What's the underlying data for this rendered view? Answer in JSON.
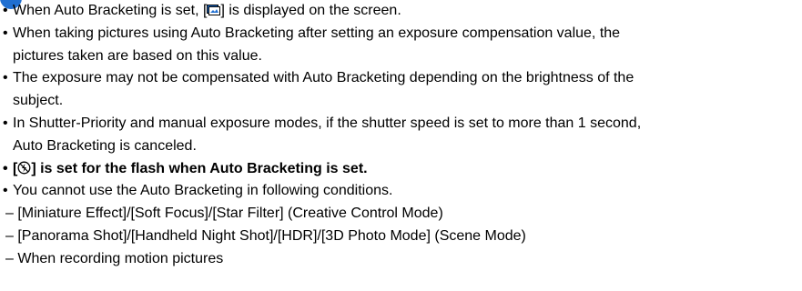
{
  "notes": {
    "icon": "note-circle-icon",
    "items": [
      {
        "type": "bullet",
        "segments": [
          "When Auto Bracketing is set, [",
          "] is displayed on the screen."
        ],
        "icon": "auto-bracket-icon"
      },
      {
        "type": "bullet",
        "text": "When taking pictures using Auto Bracketing after setting an exposure compensation value, the"
      },
      {
        "type": "cont",
        "text": "pictures taken are based on this value."
      },
      {
        "type": "bullet",
        "text": "The exposure may not be compensated with Auto Bracketing depending on the brightness of the"
      },
      {
        "type": "cont",
        "text": "subject."
      },
      {
        "type": "bullet",
        "text": "In Shutter-Priority and manual exposure modes, if the shutter speed is set to more than 1 second,"
      },
      {
        "type": "cont",
        "text": "Auto Bracketing is canceled."
      },
      {
        "type": "bullet-bold",
        "segments": [
          "[",
          "] is set for the flash when Auto Bracketing is set."
        ],
        "icon": "flash-off-icon"
      },
      {
        "type": "bullet",
        "text": "You cannot use the Auto Bracketing in following conditions."
      },
      {
        "type": "dash",
        "text": "– [Miniature Effect]/[Soft Focus]/[Star Filter] (Creative Control Mode)"
      },
      {
        "type": "dash",
        "text": "– [Panorama Shot]/[Handheld Night Shot]/[HDR]/[3D Photo Mode] (Scene Mode)"
      },
      {
        "type": "dash",
        "text": "– When recording motion pictures"
      }
    ]
  }
}
